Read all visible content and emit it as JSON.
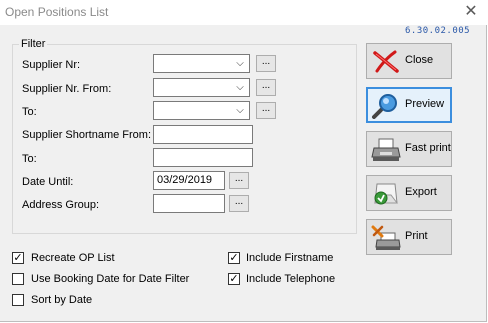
{
  "window": {
    "title": "Open Positions List",
    "version": "6.30.02.005"
  },
  "filter": {
    "legend": "Filter",
    "fields": {
      "supplier_nr": {
        "label": "Supplier Nr:",
        "value": ""
      },
      "supplier_nr_from": {
        "label": "Supplier Nr. From:",
        "value": ""
      },
      "supplier_nr_to": {
        "label": "To:",
        "value": ""
      },
      "shortname_from": {
        "label": "Supplier Shortname From:",
        "value": ""
      },
      "shortname_to": {
        "label": "To:",
        "value": ""
      },
      "date_until": {
        "label": "Date Until:",
        "value": "03/29/2019"
      },
      "address_group": {
        "label": "Address Group:",
        "value": ""
      }
    },
    "ellipsis": "..."
  },
  "options": {
    "recreate_op_list": {
      "label": "Recreate OP List",
      "checked": true
    },
    "use_booking_date": {
      "label": "Use Booking Date for Date Filter",
      "checked": false
    },
    "sort_by_date": {
      "label": "Sort by Date",
      "checked": false
    },
    "include_firstname": {
      "label": "Include Firstname",
      "checked": true
    },
    "include_telephone": {
      "label": "Include Telephone",
      "checked": true
    }
  },
  "buttons": {
    "close": "Close",
    "preview": "Preview",
    "fast_print": "Fast print",
    "export": "Export",
    "print": "Print"
  },
  "colors": {
    "dialog_bg": "#f0f0f0",
    "version_text": "#2a58a8",
    "focus_border": "#3c8ede"
  }
}
